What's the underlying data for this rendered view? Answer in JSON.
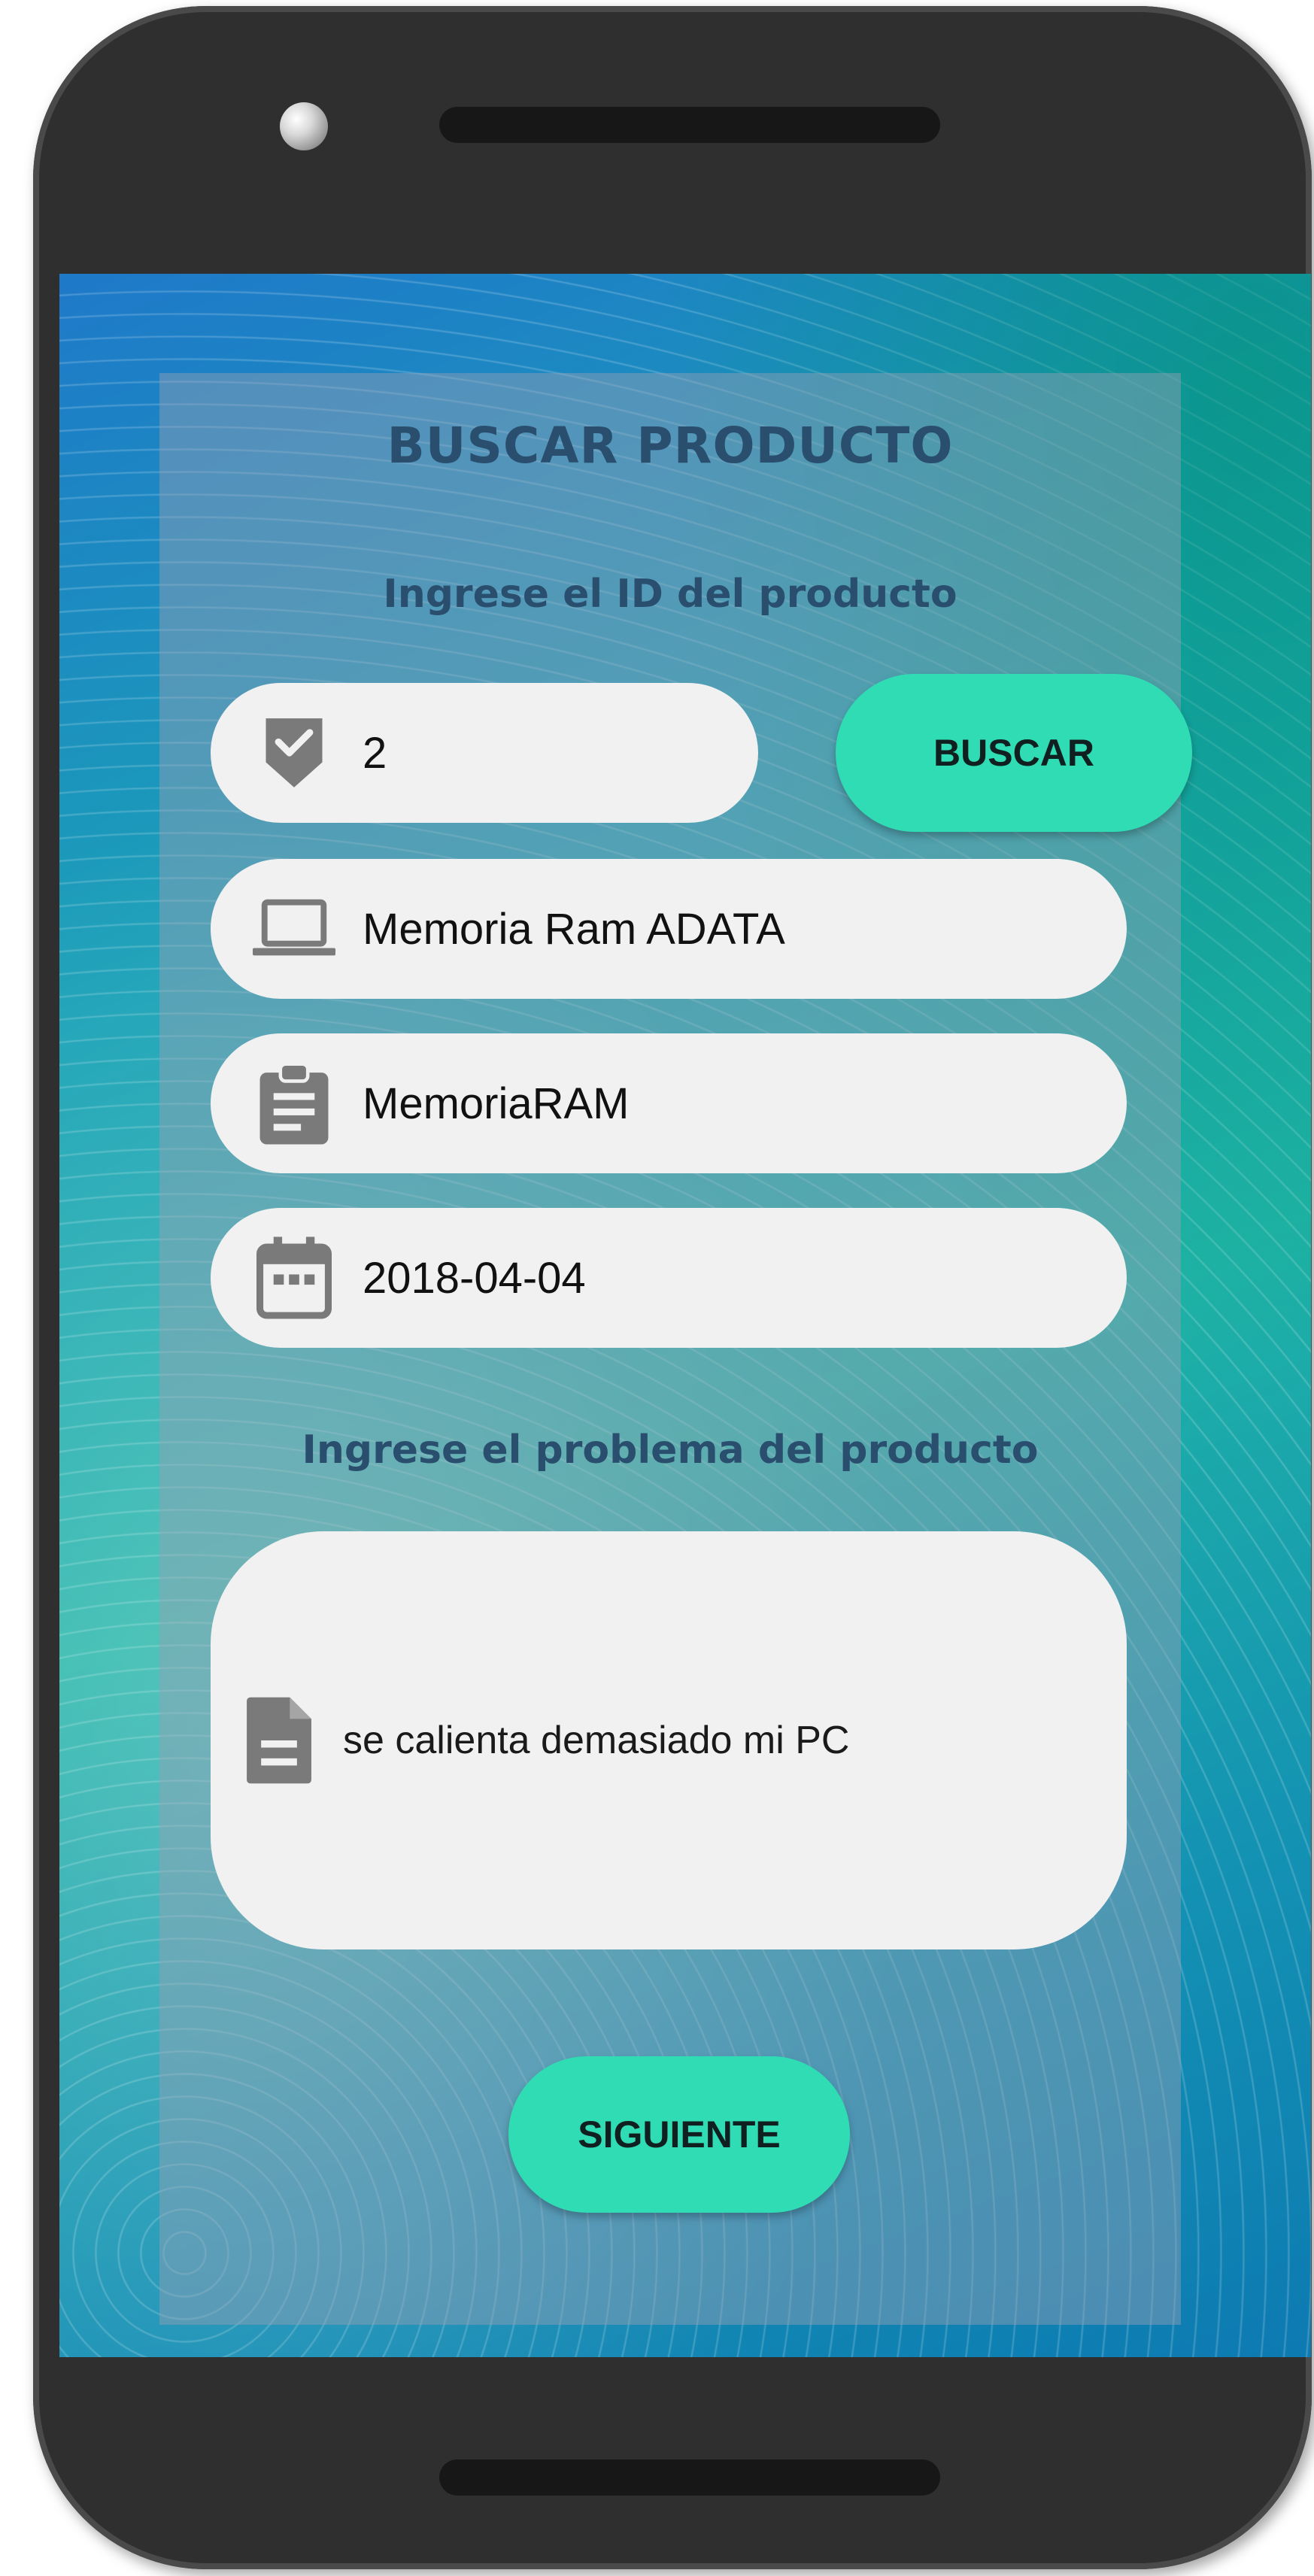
{
  "header": {
    "title": "BUSCAR PRODUCTO"
  },
  "form": {
    "id_prompt": "Ingrese el ID del producto",
    "id_value": "2",
    "search_label": "BUSCAR",
    "product_name": "Memoria Ram ADATA",
    "category": "MemoriaRAM",
    "date": "2018-04-04",
    "problem_prompt": "Ingrese el problema del producto",
    "problem_value": "se calienta demasiado mi PC",
    "next_label": "SIGUIENTE"
  },
  "icons": {
    "id_field": "shield-check-icon",
    "name_field": "laptop-icon",
    "category_field": "clipboard-icon",
    "date_field": "calendar-icon",
    "problem_field": "document-icon"
  },
  "colors": {
    "accent_button": "#30dcb4",
    "field_background": "#f1f1f1",
    "heading_text": "#2a4f6e",
    "icon_gray": "#7a7a7a"
  }
}
